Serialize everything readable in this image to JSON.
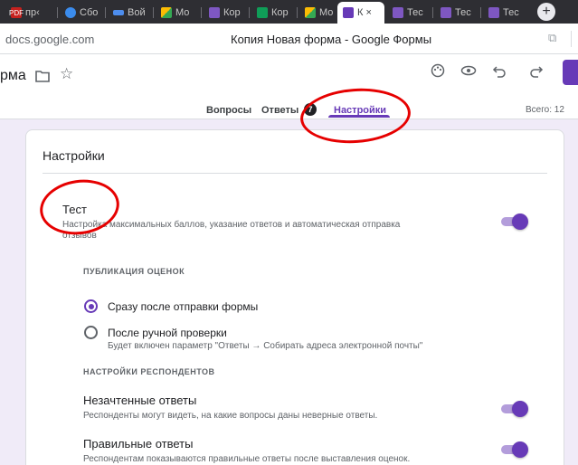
{
  "browser": {
    "tabs": [
      {
        "label": "пр‹",
        "favicon_text": "PDF",
        "favicon_color": "#c5221f"
      },
      {
        "label": "Сбо",
        "favicon_text": "",
        "favicon_color": "#3b8ced"
      },
      {
        "label": "Вой",
        "favicon_text": "",
        "favicon_color": "#4d8dee"
      },
      {
        "label": "Мо",
        "favicon_text": "",
        "favicon_color": "#fbbc04"
      },
      {
        "label": "Кор",
        "favicon_text": "",
        "favicon_color": "#7e57c2"
      },
      {
        "label": "Кор",
        "favicon_text": "",
        "favicon_color": "#0f9d58"
      },
      {
        "label": "Мо",
        "favicon_text": "",
        "favicon_color": "#fbbc04"
      },
      {
        "label": "К ×",
        "favicon_text": "",
        "favicon_color": "#673ab7"
      },
      {
        "label": "Тес",
        "favicon_text": "",
        "favicon_color": "#7e57c2"
      },
      {
        "label": "Тес",
        "favicon_text": "",
        "favicon_color": "#7e57c2"
      },
      {
        "label": "Тес",
        "favicon_text": "",
        "favicon_color": "#7e57c2"
      }
    ],
    "url_domain": "docs.google.com",
    "page_title": "Копия Новая форма - Google Формы",
    "new_tab_icon": "plus-icon"
  },
  "header": {
    "doc_title": "рма",
    "icons": [
      "folder-icon",
      "star-icon",
      "palette-icon",
      "eye-icon",
      "undo-icon",
      "redo-icon"
    ],
    "tabs": [
      {
        "label": "Вопросы"
      },
      {
        "label": "Ответы"
      },
      {
        "label": "Настройки"
      }
    ],
    "responses_badge": "7",
    "total": "Всего: 12",
    "accent_color": "#673ab7"
  },
  "settings": {
    "card_title": "Настройки",
    "quiz": {
      "title": "Тест",
      "description_line1": "Настройка максимальных баллов, указание ответов и автоматическая отправка",
      "description_line2": "отзывов",
      "enabled": true
    },
    "grades_section": "ПУБЛИКАЦИЯ ОЦЕНОК",
    "grades_options": [
      {
        "label": "Сразу после отправки формы",
        "checked": true
      },
      {
        "label": "После ручной проверки",
        "checked": false
      }
    ],
    "manual_hint": "Будет включен параметр \"Ответы → Собирать адреса электронной почты\"",
    "respondent_section": "НАСТРОЙКИ РЕСПОНДЕНТОВ",
    "missed": {
      "title": "Незачтенные ответы",
      "description": "Респонденты могут видеть, на какие вопросы даны неверные ответы.",
      "enabled": true
    },
    "correct": {
      "title": "Правильные ответы",
      "description": "Респондентам показываются правильные ответы после выставления оценок.",
      "enabled": true
    }
  },
  "annotation_color": "#e60000"
}
